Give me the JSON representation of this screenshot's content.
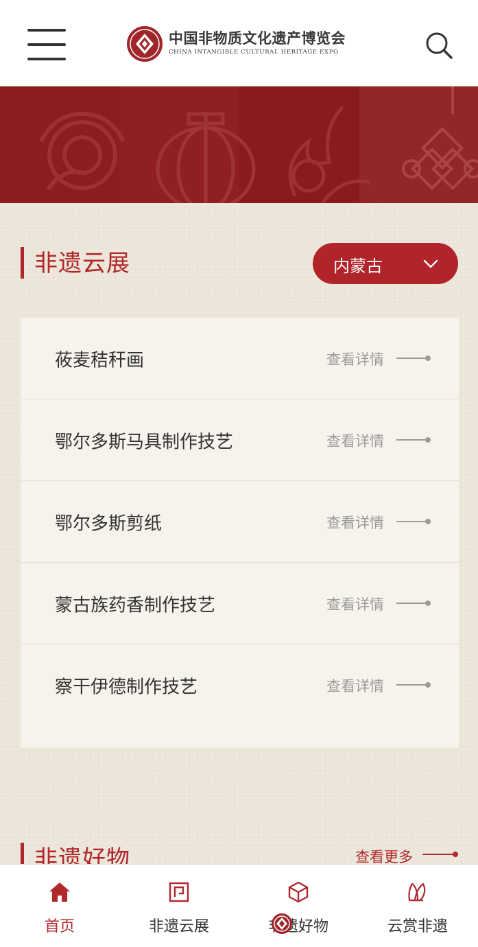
{
  "header": {
    "logo_cn": "中国非物质文化遗产博览会",
    "logo_en": "CHINA INTANGIBLE CULTURAL HERITAGE EXPO",
    "menu_icon": "hamburger-menu-icon",
    "search_icon": "search-icon"
  },
  "section_exhibit": {
    "title": "非遗云展",
    "region_select": "内蒙古",
    "items": [
      {
        "title": "莜麦秸秆画",
        "more": "查看详情"
      },
      {
        "title": "鄂尔多斯马具制作技艺",
        "more": "查看详情"
      },
      {
        "title": "鄂尔多斯剪纸",
        "more": "查看详情"
      },
      {
        "title": "蒙古族药香制作技艺",
        "more": "查看详情"
      },
      {
        "title": "察干伊德制作技艺",
        "more": "查看详情"
      }
    ]
  },
  "section_goods": {
    "title": "非遗好物",
    "more": "查看更多"
  },
  "bottom_nav": [
    {
      "label": "首页",
      "icon": "home-icon",
      "active": true
    },
    {
      "label": "非遗云展",
      "icon": "exhibit-frame-icon",
      "active": false
    },
    {
      "label": "非遗好物",
      "icon": "box-icon",
      "active": false
    },
    {
      "label": "云赏非遗",
      "icon": "fan-icon",
      "active": false
    }
  ],
  "colors": {
    "brand_red": "#b0282c",
    "banner_red": "#8a1b1f",
    "page_bg": "#ece6da",
    "card_bg": "#f6f3ed"
  }
}
